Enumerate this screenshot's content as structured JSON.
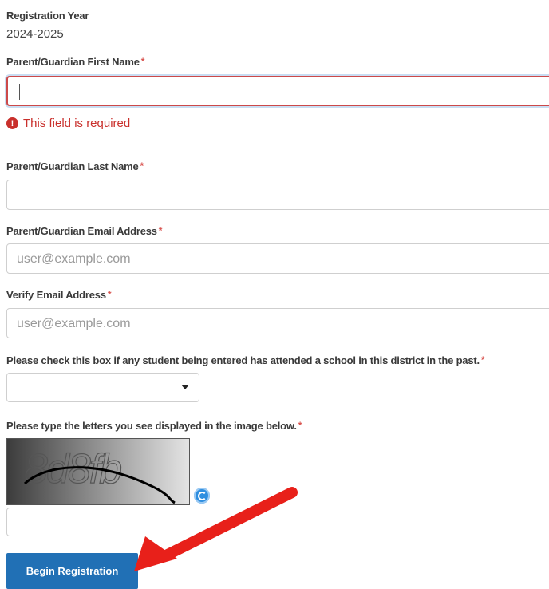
{
  "registration_year": {
    "label": "Registration Year",
    "value": "2024-2025"
  },
  "first_name": {
    "label": "Parent/Guardian First Name",
    "required_mark": "*",
    "value": "",
    "error": "This field is required"
  },
  "last_name": {
    "label": "Parent/Guardian Last Name",
    "required_mark": "*",
    "value": ""
  },
  "email": {
    "label": "Parent/Guardian Email Address",
    "required_mark": "*",
    "placeholder": "user@example.com"
  },
  "verify_email": {
    "label": "Verify Email Address",
    "required_mark": "*",
    "placeholder": "user@example.com"
  },
  "attended": {
    "label": "Please check this box if any student being entered has attended a school in this district in the past.",
    "required_mark": "*",
    "selected": ""
  },
  "captcha": {
    "label": "Please type the letters you see displayed in the image below.",
    "required_mark": "*",
    "image_text": "8d8fb",
    "value": ""
  },
  "submit": {
    "label": "Begin Registration"
  },
  "colors": {
    "error": "#c9302c",
    "button": "#2170b5",
    "arrow": "#e8201a"
  },
  "icons": {
    "error": "exclamation-circle-icon",
    "select": "chevron-down-icon",
    "refresh": "refresh-icon"
  }
}
